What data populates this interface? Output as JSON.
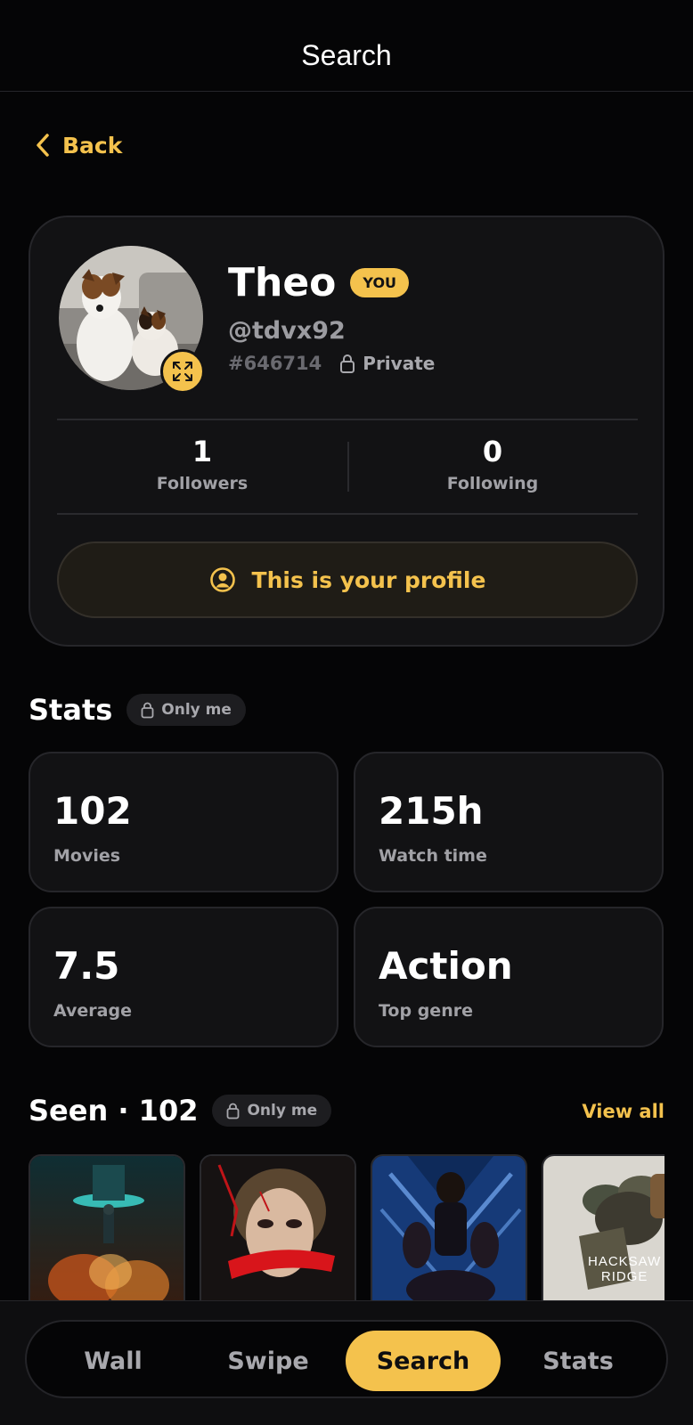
{
  "header": {
    "title": "Search"
  },
  "back": {
    "label": "Back"
  },
  "profile": {
    "name": "Theo",
    "you_badge": "YOU",
    "handle": "@tdvx92",
    "id_tag": "#646714",
    "privacy": "Private",
    "followers": {
      "count": "1",
      "label": "Followers"
    },
    "following": {
      "count": "0",
      "label": "Following"
    },
    "own_profile_label": "This is your profile"
  },
  "stats_section": {
    "title": "Stats",
    "privacy": "Only me",
    "cards": [
      {
        "value": "102",
        "label": "Movies"
      },
      {
        "value": "215h",
        "label": "Watch time"
      },
      {
        "value": "7.5",
        "label": "Average"
      },
      {
        "value": "Action",
        "label": "Top genre"
      }
    ]
  },
  "seen_section": {
    "title": "Seen · 102",
    "privacy": "Only me",
    "view_all": "View all",
    "posters": [
      {
        "icon": "poster-sci-fi"
      },
      {
        "icon": "poster-horror-face"
      },
      {
        "icon": "poster-black-panther"
      },
      {
        "icon": "poster-hacksaw-ridge",
        "caption_1": "HACKSAW",
        "caption_2": "RIDGE"
      }
    ]
  },
  "bottom_nav": {
    "items": [
      {
        "label": "Wall"
      },
      {
        "label": "Swipe"
      },
      {
        "label": "Search"
      },
      {
        "label": "Stats"
      }
    ],
    "active": "Search"
  },
  "colors": {
    "accent": "#f4c24d",
    "background": "#050506",
    "card": "#121214"
  }
}
